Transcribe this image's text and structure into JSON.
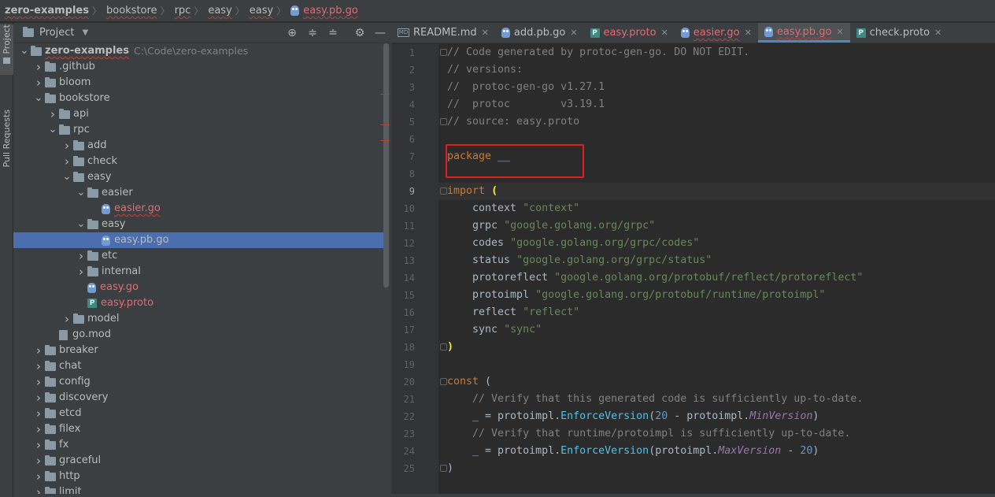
{
  "breadcrumb": [
    "zero-examples",
    "bookstore",
    "rpc",
    "easy",
    "easy",
    "easy.pb.go"
  ],
  "toolstrip": {
    "project_label": "Project",
    "pull_requests_label": "Pull Requests"
  },
  "project_panel": {
    "title": "Project",
    "tree": [
      {
        "name": "zero-examples",
        "path": "C:\\Code\\zero-examples",
        "depth": 0,
        "type": "root",
        "expanded": true
      },
      {
        "name": ".github",
        "depth": 1,
        "type": "folder",
        "expanded": false
      },
      {
        "name": "bloom",
        "depth": 1,
        "type": "folder",
        "expanded": false
      },
      {
        "name": "bookstore",
        "depth": 1,
        "type": "folder",
        "expanded": true
      },
      {
        "name": "api",
        "depth": 2,
        "type": "folder",
        "expanded": false
      },
      {
        "name": "rpc",
        "depth": 2,
        "type": "folder",
        "expanded": true
      },
      {
        "name": "add",
        "depth": 3,
        "type": "folder",
        "expanded": false
      },
      {
        "name": "check",
        "depth": 3,
        "type": "folder",
        "expanded": false
      },
      {
        "name": "easy",
        "depth": 3,
        "type": "folder",
        "expanded": true
      },
      {
        "name": "easier",
        "depth": 4,
        "type": "folder",
        "expanded": true
      },
      {
        "name": "easier.go",
        "depth": 5,
        "type": "go",
        "style": "err"
      },
      {
        "name": "easy",
        "depth": 4,
        "type": "folder",
        "expanded": true
      },
      {
        "name": "easy.pb.go",
        "depth": 5,
        "type": "go",
        "style": "selected"
      },
      {
        "name": "etc",
        "depth": 4,
        "type": "folder",
        "expanded": false
      },
      {
        "name": "internal",
        "depth": 4,
        "type": "folder",
        "expanded": false
      },
      {
        "name": "easy.go",
        "depth": 4,
        "type": "go",
        "style": "red"
      },
      {
        "name": "easy.proto",
        "depth": 4,
        "type": "proto",
        "style": "red"
      },
      {
        "name": "model",
        "depth": 3,
        "type": "folder",
        "expanded": false
      },
      {
        "name": "go.mod",
        "depth": 2,
        "type": "mod"
      },
      {
        "name": "breaker",
        "depth": 1,
        "type": "folder",
        "expanded": false
      },
      {
        "name": "chat",
        "depth": 1,
        "type": "folder",
        "expanded": false
      },
      {
        "name": "config",
        "depth": 1,
        "type": "folder",
        "expanded": false
      },
      {
        "name": "discovery",
        "depth": 1,
        "type": "folder",
        "expanded": false
      },
      {
        "name": "etcd",
        "depth": 1,
        "type": "folder",
        "expanded": false
      },
      {
        "name": "filex",
        "depth": 1,
        "type": "folder",
        "expanded": false
      },
      {
        "name": "fx",
        "depth": 1,
        "type": "folder",
        "expanded": false
      },
      {
        "name": "graceful",
        "depth": 1,
        "type": "folder",
        "expanded": false
      },
      {
        "name": "http",
        "depth": 1,
        "type": "folder",
        "expanded": false
      },
      {
        "name": "limit",
        "depth": 1,
        "type": "folder",
        "expanded": false
      }
    ]
  },
  "tabs": [
    {
      "label": "README.md",
      "icon": "markdown-icon",
      "style": "normal"
    },
    {
      "label": "add.pb.go",
      "icon": "go-file-icon",
      "style": "normal"
    },
    {
      "label": "easy.proto",
      "icon": "proto-file-icon",
      "style": "red"
    },
    {
      "label": "easier.go",
      "icon": "go-file-icon",
      "style": "err"
    },
    {
      "label": "easy.pb.go",
      "icon": "go-file-icon",
      "style": "err",
      "active": true
    },
    {
      "label": "check.proto",
      "icon": "proto-file-icon",
      "style": "normal"
    }
  ],
  "editor": {
    "current_line": 9,
    "lines": [
      {
        "n": "1",
        "tokens": [
          [
            "cm",
            "// Code generated by protoc-gen-go. DO NOT EDIT."
          ]
        ]
      },
      {
        "n": "2",
        "tokens": [
          [
            "cm",
            "// versions:"
          ]
        ]
      },
      {
        "n": "3",
        "tokens": [
          [
            "cm",
            "//  protoc-gen-go v1.27.1"
          ]
        ]
      },
      {
        "n": "4",
        "tokens": [
          [
            "cm",
            "//  protoc        v3.19.1"
          ]
        ]
      },
      {
        "n": "5",
        "tokens": [
          [
            "cm",
            "// source: easy.proto"
          ]
        ]
      },
      {
        "n": "6",
        "tokens": []
      },
      {
        "n": "7",
        "tokens": [
          [
            "kw",
            "package"
          ],
          [
            "",
            " __"
          ]
        ]
      },
      {
        "n": "8",
        "tokens": []
      },
      {
        "n": "9",
        "tokens": [
          [
            "kw",
            "import"
          ],
          [
            "",
            " "
          ],
          [
            "brk",
            "("
          ]
        ]
      },
      {
        "n": "10",
        "tokens": [
          [
            "",
            "    context "
          ],
          [
            "str",
            "\"context\""
          ]
        ]
      },
      {
        "n": "11",
        "tokens": [
          [
            "",
            "    grpc "
          ],
          [
            "str",
            "\"google.golang.org/grpc\""
          ]
        ]
      },
      {
        "n": "12",
        "tokens": [
          [
            "",
            "    codes "
          ],
          [
            "str",
            "\"google.golang.org/grpc/codes\""
          ]
        ]
      },
      {
        "n": "13",
        "tokens": [
          [
            "",
            "    status "
          ],
          [
            "str",
            "\"google.golang.org/grpc/status\""
          ]
        ]
      },
      {
        "n": "14",
        "tokens": [
          [
            "",
            "    protoreflect "
          ],
          [
            "str",
            "\"google.golang.org/protobuf/reflect/protoreflect\""
          ]
        ]
      },
      {
        "n": "15",
        "tokens": [
          [
            "",
            "    protoimpl "
          ],
          [
            "str",
            "\"google.golang.org/protobuf/runtime/protoimpl\""
          ]
        ]
      },
      {
        "n": "16",
        "tokens": [
          [
            "",
            "    reflect "
          ],
          [
            "str",
            "\"reflect\""
          ]
        ]
      },
      {
        "n": "17",
        "tokens": [
          [
            "",
            "    sync "
          ],
          [
            "str",
            "\"sync\""
          ]
        ]
      },
      {
        "n": "18",
        "tokens": [
          [
            "brk",
            ")"
          ]
        ]
      },
      {
        "n": "19",
        "tokens": []
      },
      {
        "n": "20",
        "tokens": [
          [
            "kw",
            "const"
          ],
          [
            "",
            " ("
          ]
        ]
      },
      {
        "n": "21",
        "tokens": [
          [
            "cm",
            "    // Verify that this generated code is sufficiently up-to-date."
          ]
        ]
      },
      {
        "n": "22",
        "tokens": [
          [
            "",
            "    _ = protoimpl."
          ],
          [
            "fn",
            "EnforceVersion"
          ],
          [
            "",
            "("
          ],
          [
            "num",
            "20"
          ],
          [
            "",
            " - protoimpl."
          ],
          [
            "it",
            "MinVersion"
          ],
          [
            "",
            ")"
          ]
        ]
      },
      {
        "n": "23",
        "tokens": [
          [
            "cm",
            "    // Verify that runtime/protoimpl is sufficiently up-to-date."
          ]
        ]
      },
      {
        "n": "24",
        "tokens": [
          [
            "",
            "    _ = protoimpl."
          ],
          [
            "fn",
            "EnforceVersion"
          ],
          [
            "",
            "(protoimpl."
          ],
          [
            "it",
            "MaxVersion"
          ],
          [
            "",
            " - "
          ],
          [
            "num",
            "20"
          ],
          [
            "",
            ")"
          ]
        ]
      },
      {
        "n": "25",
        "tokens": [
          [
            "",
            ")"
          ]
        ]
      }
    ]
  }
}
